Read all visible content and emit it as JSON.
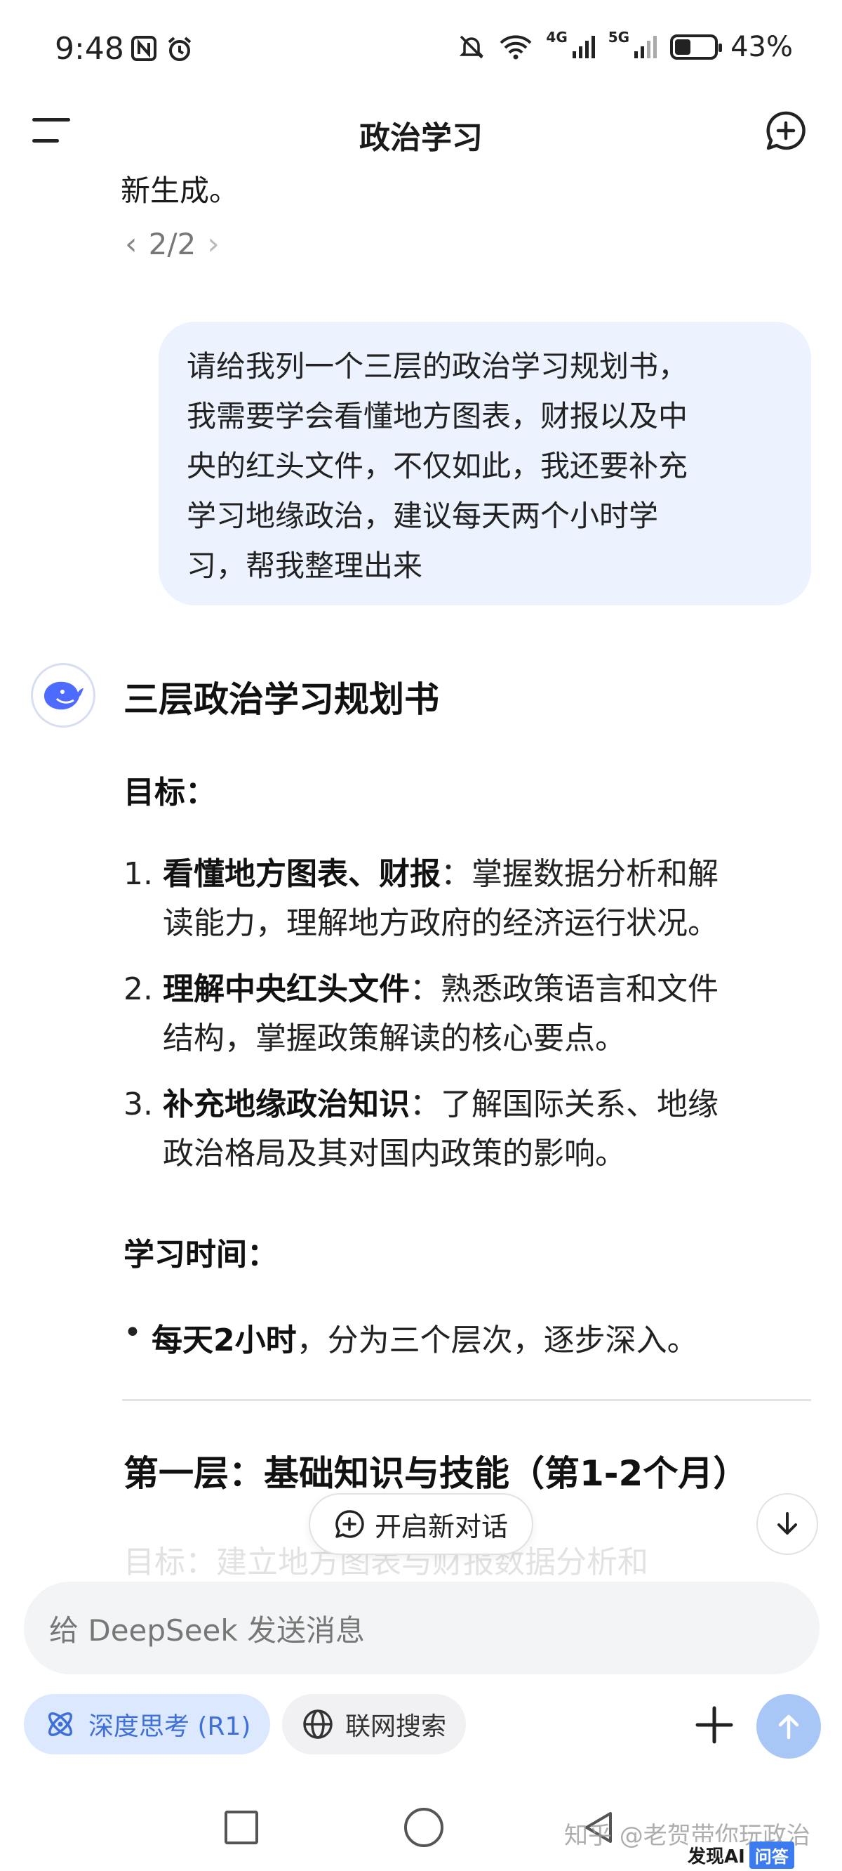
{
  "status_bar": {
    "time": "9:48",
    "net_4g": "4G",
    "net_5g": "5G",
    "battery": "43%",
    "battery_level": 0.43
  },
  "header": {
    "title": "政治学习"
  },
  "conversation": {
    "prev_answer_tail": "新生成。",
    "pager": "2/2",
    "user_message_lines": [
      "请给我列一个三层的政治学习规划书，",
      "我需要学会看懂地方图表，财报以及中",
      "央的红头文件，不仅如此，我还要补充",
      "学习地缘政治，建议每天两个小时学",
      "习，帮我整理出来"
    ],
    "response": {
      "title": "三层政治学习规划书",
      "goal_label": "目标：",
      "goals": [
        {
          "num": "1.",
          "bold": "看懂地方图表、财报",
          "line1": "：掌握数据分析和解",
          "line2": "读能力，理解地方政府的经济运行状况。"
        },
        {
          "num": "2.",
          "bold": "理解中央红头文件",
          "line1": "：熟悉政策语言和文件",
          "line2": "结构，掌握政策解读的核心要点。"
        },
        {
          "num": "3.",
          "bold": "补充地缘政治知识",
          "line1": "：了解国际关系、地缘",
          "line2": "政治格局及其对国内政策的影响。"
        }
      ],
      "time_label": "学习时间：",
      "time_bold": "每天2小时",
      "time_rest": "，分为三个层次，逐步深入。",
      "layer1_title": "第一层：基础知识与技能（第1-2个月）",
      "faded_text": "目标：建立地方图表与财报数据分析和"
    }
  },
  "floating": {
    "new_conversation": "开启新对话"
  },
  "input": {
    "placeholder": "给 DeepSeek 发送消息"
  },
  "chips": {
    "deep_think": "深度思考 (R1)",
    "web_search": "联网搜索"
  },
  "watermark": {
    "text": "知乎 @老贺带你玩政治",
    "brand": "发现AI",
    "brand_tag": "问答"
  },
  "colors": {
    "accent": "#3f6fd8",
    "bubble": "#edf3fe",
    "send": "#a9c7f6"
  }
}
